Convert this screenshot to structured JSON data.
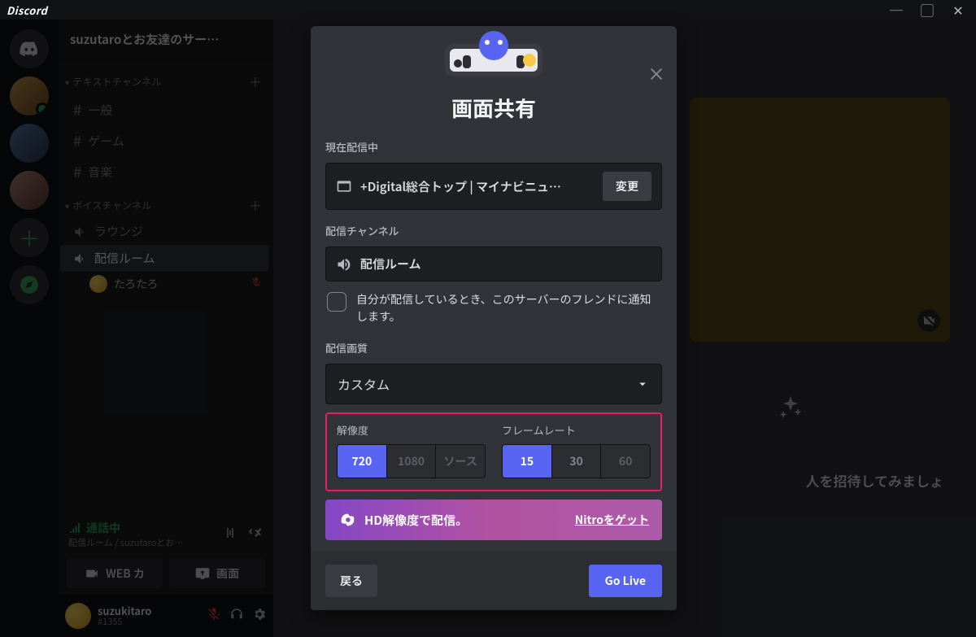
{
  "titlebar": {
    "brand": "Discord"
  },
  "server": {
    "name": "suzutaroとお友達のサー…"
  },
  "categories": {
    "text": {
      "label": "テキストチャンネル"
    },
    "voice": {
      "label": "ボイスチャンネル"
    }
  },
  "textChannels": [
    {
      "name": "一般"
    },
    {
      "name": "ゲーム"
    },
    {
      "name": "音楽"
    }
  ],
  "voiceChannels": [
    {
      "name": "ラウンジ"
    },
    {
      "name": "配信ルーム",
      "selected": true
    }
  ],
  "voiceMembers": [
    {
      "name": "たろたろ",
      "muted": true
    }
  ],
  "voiceStatus": {
    "label": "通話中",
    "sub": "配信ルーム / suzutaroとお…",
    "btnCamera": "WEB カ",
    "btnScreen": "画面"
  },
  "user": {
    "name": "suzukitaro",
    "tag": "#1355"
  },
  "inviteText": "人を招待してみましょ",
  "modal": {
    "title": "画面共有",
    "nowStreamingLabel": "現在配信中",
    "sourceName": "+Digital総合トップ | マイナビニュ…",
    "changeBtn": "変更",
    "channelLabel": "配信チャンネル",
    "channelName": "配信ルーム",
    "notifyText": "自分が配信しているとき、このサーバーのフレンドに通知します。",
    "qualityLabel": "配信画質",
    "presetName": "カスタム",
    "resolution": {
      "label": "解像度",
      "opts": [
        "720",
        "1080",
        "ソース"
      ],
      "selected": 0
    },
    "framerate": {
      "label": "フレームレート",
      "opts": [
        "15",
        "30",
        "60"
      ],
      "selected": 0
    },
    "nitroText": "HD解像度で配信。",
    "nitroLink": "Nitroをゲット",
    "backBtn": "戻る",
    "goLiveBtn": "Go Live"
  }
}
